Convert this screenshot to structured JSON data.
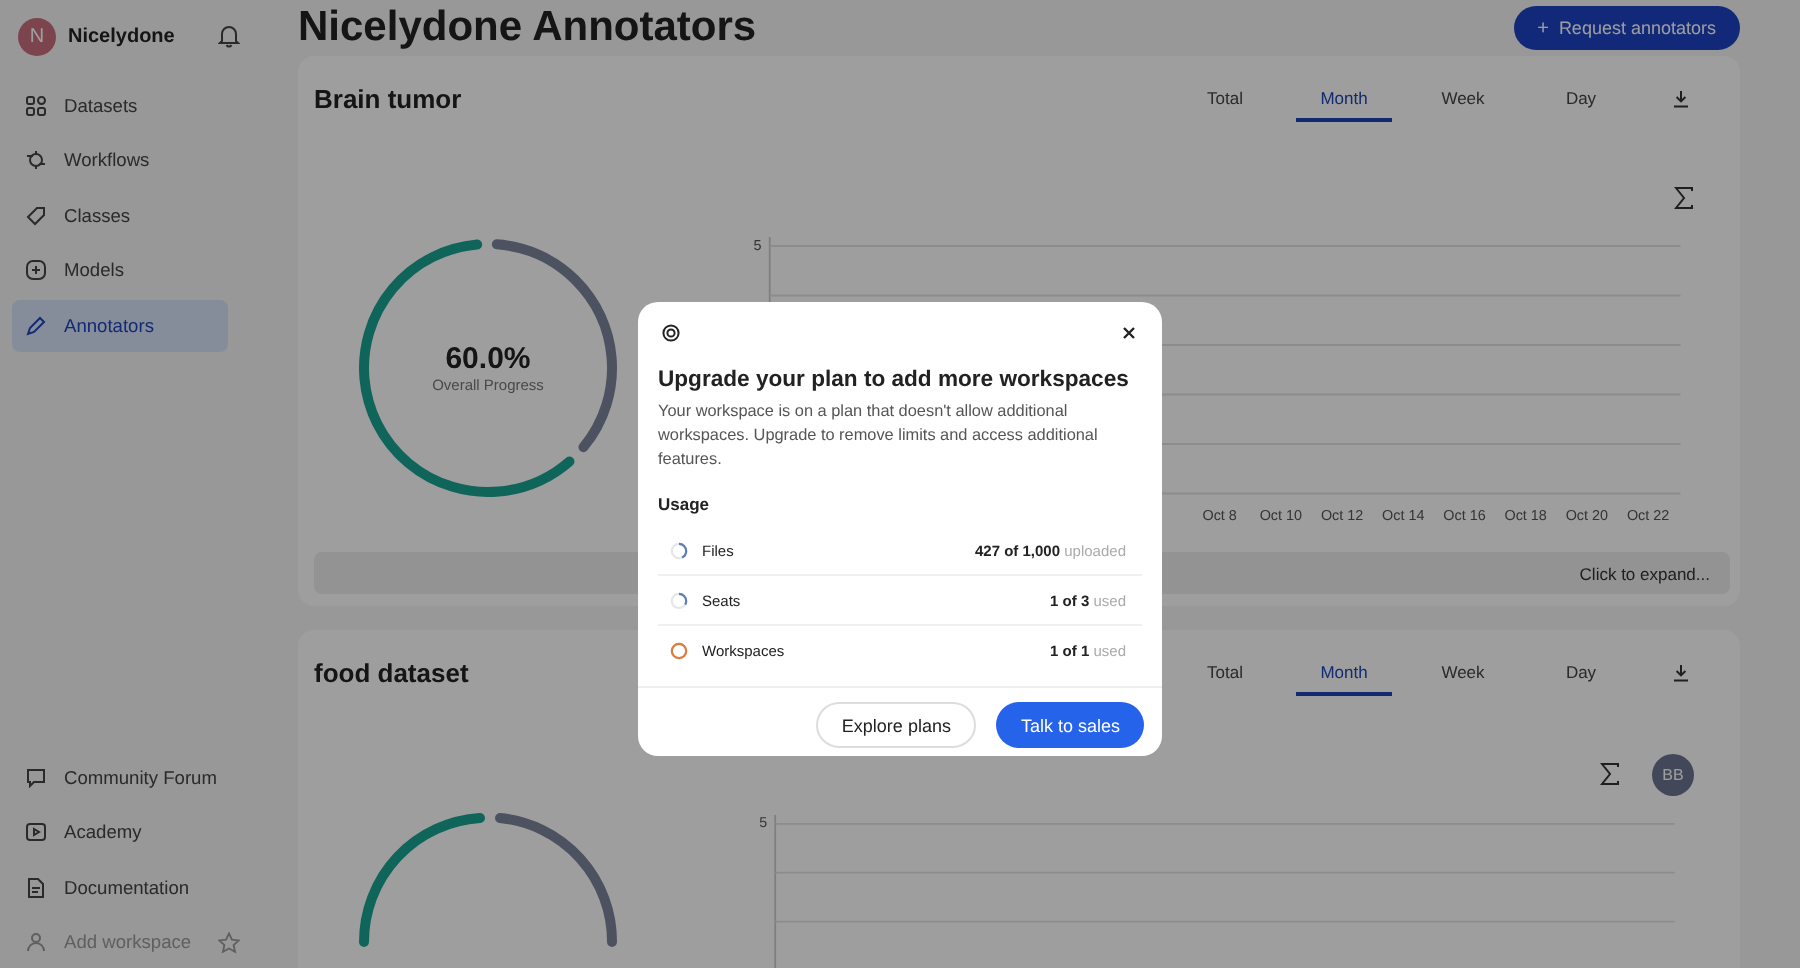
{
  "sidebar": {
    "workspace": {
      "avatar_letter": "N",
      "name": "Nicelydone"
    },
    "items": [
      {
        "label": "Datasets",
        "selected": false
      },
      {
        "label": "Workflows",
        "selected": false
      },
      {
        "label": "Classes",
        "selected": false
      },
      {
        "label": "Models",
        "selected": false
      },
      {
        "label": "Annotators",
        "selected": true
      }
    ],
    "footer_items": [
      {
        "label": "Community Forum",
        "disabled": false,
        "starred": false
      },
      {
        "label": "Academy",
        "disabled": false,
        "starred": false
      },
      {
        "label": "Documentation",
        "disabled": false,
        "starred": false
      },
      {
        "label": "Add workspace",
        "disabled": true,
        "starred": true
      }
    ]
  },
  "header": {
    "title": "Nicelydone Annotators",
    "action": {
      "icon": "+",
      "label": "Request annotators"
    }
  },
  "projects": [
    {
      "title": "Brain tumor",
      "tabs": [
        {
          "label": "Total",
          "selected": false
        },
        {
          "label": "Month",
          "selected": true
        },
        {
          "label": "Week",
          "selected": false
        },
        {
          "label": "Day",
          "selected": false
        }
      ],
      "progress": {
        "level": 0.6,
        "value": "60.0%",
        "label": "Overall Progress"
      },
      "chart": {
        "y_tick": "5",
        "x_labels": [
          "Oct 8",
          "Oct 10",
          "Oct 12",
          "Oct 14",
          "Oct 16",
          "Oct 18",
          "Oct 20",
          "Oct 22"
        ]
      },
      "expand_label": "Click to expand..."
    },
    {
      "title": "food dataset",
      "tabs": [
        {
          "label": "Total",
          "selected": false
        },
        {
          "label": "Month",
          "selected": true
        },
        {
          "label": "Week",
          "selected": false
        },
        {
          "label": "Day",
          "selected": false
        }
      ],
      "chart": {
        "y_tick": "5"
      },
      "avatar": "BB"
    }
  ],
  "modal": {
    "title": "Upgrade your plan to add more workspaces",
    "description": "Your workspace is on a plan that doesn't allow additional workspaces. Upgrade to remove limits and access additional features.",
    "usage_title": "Usage",
    "usage": [
      {
        "label": "Files",
        "count": "427 of 1,000",
        "unit": "uploaded",
        "level": 0.427,
        "color": "#5b7db8"
      },
      {
        "label": "Seats",
        "count": "1 of 3",
        "unit": "used",
        "level": 0.333,
        "color": "#5b7db8"
      },
      {
        "label": "Workspaces",
        "count": "1 of 1",
        "unit": "used",
        "level": 1,
        "color": "#e07a3c"
      }
    ],
    "buttons": [
      {
        "label": "Explore plans",
        "kind": "secondary"
      },
      {
        "label": "Talk to sales",
        "kind": "primary"
      }
    ]
  }
}
